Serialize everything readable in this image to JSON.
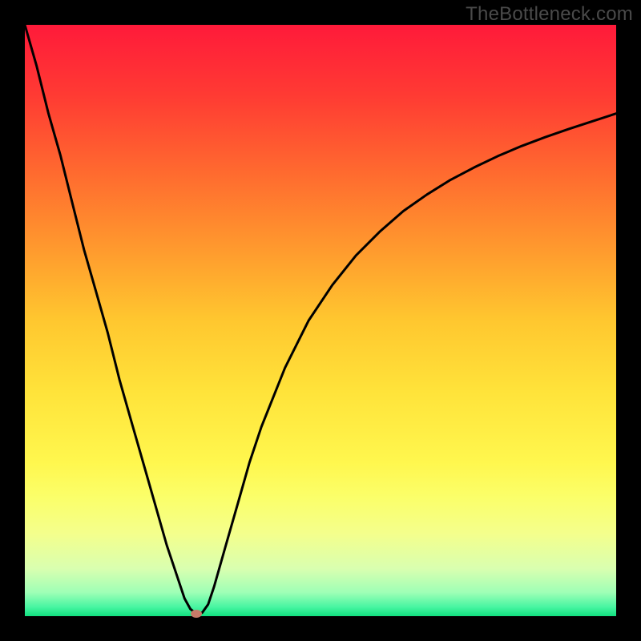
{
  "watermark": {
    "text": "TheBottleneck.com"
  },
  "chart_data": {
    "type": "line",
    "title": "",
    "xlabel": "",
    "ylabel": "",
    "xlim": [
      0,
      100
    ],
    "ylim": [
      0,
      100
    ],
    "grid": false,
    "legend": null,
    "background_gradient": {
      "stops": [
        {
          "pos": 0.0,
          "color": "#ff1a3a"
        },
        {
          "pos": 0.12,
          "color": "#ff3b33"
        },
        {
          "pos": 0.25,
          "color": "#ff6a2f"
        },
        {
          "pos": 0.38,
          "color": "#ff9a2e"
        },
        {
          "pos": 0.5,
          "color": "#ffc72f"
        },
        {
          "pos": 0.62,
          "color": "#ffe33a"
        },
        {
          "pos": 0.74,
          "color": "#fff74e"
        },
        {
          "pos": 0.8,
          "color": "#fbff6a"
        },
        {
          "pos": 0.86,
          "color": "#f4ff8c"
        },
        {
          "pos": 0.92,
          "color": "#d9ffb0"
        },
        {
          "pos": 0.96,
          "color": "#9effb6"
        },
        {
          "pos": 0.985,
          "color": "#46f5a1"
        },
        {
          "pos": 1.0,
          "color": "#11e07f"
        }
      ]
    },
    "series": [
      {
        "name": "bottleneck-curve",
        "color": "#000000",
        "stroke_width": 3,
        "x": [
          0,
          2,
          4,
          6,
          8,
          10,
          12,
          14,
          16,
          18,
          20,
          22,
          24,
          26,
          27,
          28,
          29,
          30,
          31,
          32,
          34,
          36,
          38,
          40,
          44,
          48,
          52,
          56,
          60,
          64,
          68,
          72,
          76,
          80,
          84,
          88,
          92,
          96,
          100
        ],
        "values": [
          101,
          93,
          85,
          78,
          70,
          62,
          55,
          48,
          40,
          33,
          26,
          19,
          12,
          6,
          3,
          1.2,
          0.4,
          0.6,
          2,
          5,
          12,
          19,
          26,
          32,
          42,
          50,
          56,
          61,
          65,
          68.5,
          71.3,
          73.8,
          75.9,
          77.8,
          79.5,
          81.0,
          82.4,
          83.7,
          85.0
        ]
      }
    ],
    "marker": {
      "name": "optimum-point",
      "x": 29,
      "y": 0.4,
      "color": "#c77b69",
      "rx": 7,
      "ry": 5
    }
  }
}
